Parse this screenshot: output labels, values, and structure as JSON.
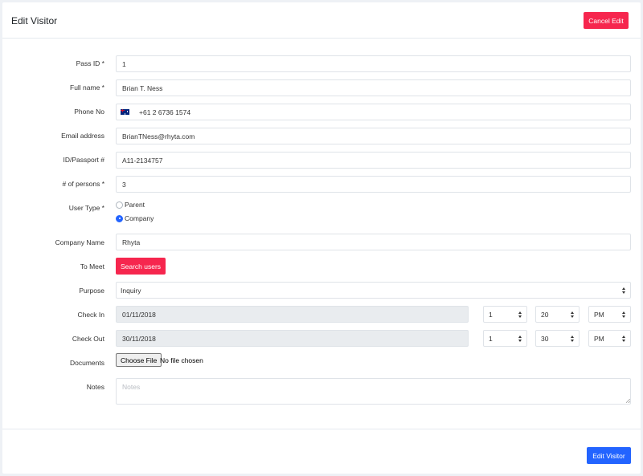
{
  "header": {
    "title": "Edit Visitor",
    "cancel_label": "Cancel Edit"
  },
  "form": {
    "pass_id": {
      "label": "Pass ID *",
      "value": "1"
    },
    "full_name": {
      "label": "Full name *",
      "value": "Brian T. Ness"
    },
    "phone": {
      "label": "Phone No",
      "flag": "australia-flag-icon",
      "value": "+61 2 6736 1574"
    },
    "email": {
      "label": "Email address",
      "value": "BrianTNess@rhyta.com"
    },
    "id_passport": {
      "label": "ID/Passport #",
      "value": "A11-2134757"
    },
    "persons": {
      "label": "# of persons *",
      "value": "3"
    },
    "user_type": {
      "label": "User Type *",
      "options": [
        {
          "label": "Parent",
          "checked": false
        },
        {
          "label": "Company",
          "checked": true
        }
      ]
    },
    "company_name": {
      "label": "Company Name",
      "value": "Rhyta"
    },
    "to_meet": {
      "label": "To Meet",
      "button_label": "Search users"
    },
    "purpose": {
      "label": "Purpose",
      "value": "Inquiry"
    },
    "check_in": {
      "label": "Check In",
      "date": "01/11/2018",
      "hour": "1",
      "minute": "20",
      "ampm": "PM"
    },
    "check_out": {
      "label": "Check Out",
      "date": "30/11/2018",
      "hour": "1",
      "minute": "30",
      "ampm": "PM"
    },
    "documents": {
      "label": "Documents",
      "button_label": "Choose File",
      "status": "No file chosen"
    },
    "notes": {
      "label": "Notes",
      "placeholder": "Notes"
    }
  },
  "footer": {
    "submit_label": "Edit Visitor"
  },
  "colors": {
    "danger": "#f6264e",
    "primary": "#2364ff",
    "disabled_bg": "#e9ecef"
  }
}
